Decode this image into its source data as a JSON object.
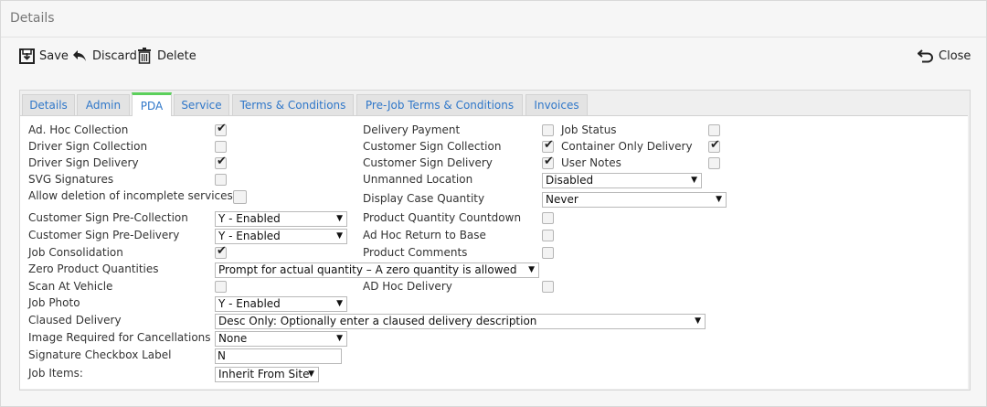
{
  "window": {
    "title": "Details"
  },
  "toolbar": {
    "save": "Save",
    "discard": "Discard",
    "delete": "Delete",
    "close": "Close"
  },
  "tabs": [
    "Details",
    "Admin",
    "PDA",
    "Service",
    "Terms & Conditions",
    "Pre-Job Terms & Conditions",
    "Invoices"
  ],
  "active_tab": "PDA",
  "left": {
    "ad_hoc_collection": {
      "label": "Ad. Hoc Collection",
      "checked": true
    },
    "driver_sign_collection": {
      "label": "Driver Sign Collection",
      "checked": false
    },
    "driver_sign_delivery": {
      "label": "Driver Sign Delivery",
      "checked": true
    },
    "svg_signatures": {
      "label": "SVG Signatures",
      "checked": false
    },
    "allow_deletion": {
      "label": "Allow deletion of incomplete services",
      "checked": false
    },
    "customer_sign_pre_collection": {
      "label": "Customer Sign Pre-Collection",
      "value": "Y - Enabled"
    },
    "customer_sign_pre_delivery": {
      "label": "Customer Sign Pre-Delivery",
      "value": "Y - Enabled"
    },
    "job_consolidation": {
      "label": "Job Consolidation",
      "checked": true
    },
    "zero_product_quantities": {
      "label": "Zero Product Quantities",
      "value": "Prompt for actual quantity – A zero quantity is allowed"
    },
    "scan_at_vehicle": {
      "label": "Scan At Vehicle",
      "checked": false
    },
    "job_photo": {
      "label": "Job Photo",
      "value": "Y - Enabled"
    },
    "claused_delivery": {
      "label": "Claused Delivery",
      "value": "Desc Only: Optionally enter a claused delivery description"
    },
    "image_required": {
      "label": "Image Required for Cancellations",
      "value": "None"
    },
    "signature_checkbox_label": {
      "label": "Signature Checkbox Label",
      "value": "N"
    },
    "job_items": {
      "label": "Job Items:",
      "value": "Inherit From Site"
    }
  },
  "middle": {
    "delivery_payment": {
      "label": "Delivery Payment",
      "checked": false
    },
    "customer_sign_collection": {
      "label": "Customer Sign Collection",
      "checked": true
    },
    "customer_sign_delivery": {
      "label": "Customer Sign Delivery",
      "checked": true
    },
    "unmanned_location": {
      "label": "Unmanned Location",
      "value": "Disabled"
    },
    "display_case_quantity": {
      "label": "Display Case Quantity",
      "value": "Never"
    },
    "product_quantity_countdown": {
      "label": "Product Quantity Countdown",
      "checked": false
    },
    "ad_hoc_return_to_base": {
      "label": "Ad Hoc Return to Base",
      "checked": false
    },
    "product_comments": {
      "label": "Product Comments",
      "checked": false
    },
    "ad_hoc_delivery": {
      "label": "AD Hoc Delivery",
      "checked": false
    }
  },
  "right": {
    "job_status": {
      "label": "Job Status",
      "checked": false
    },
    "container_only_delivery": {
      "label": "Container Only Delivery",
      "checked": true
    },
    "user_notes": {
      "label": "User Notes",
      "checked": false
    }
  },
  "icons": {
    "check": "✔",
    "dropdown_arrow": "▼"
  }
}
